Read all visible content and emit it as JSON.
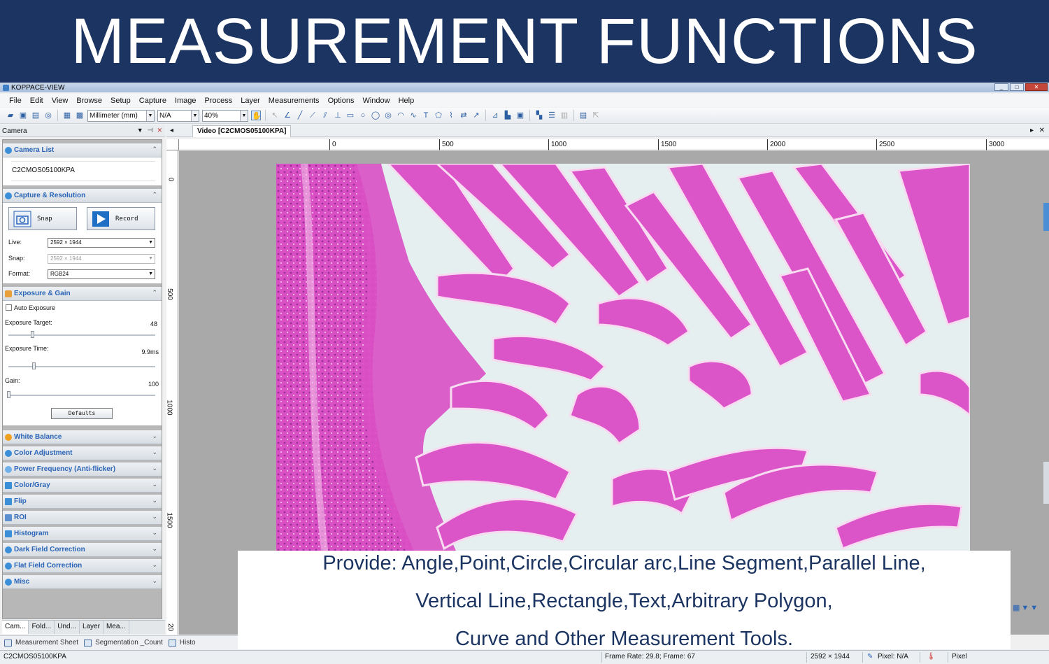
{
  "banner": {
    "title": "MEASUREMENT FUNCTIONS"
  },
  "window": {
    "title": "KOPPACE-VIEW"
  },
  "menu": [
    "File",
    "Edit",
    "View",
    "Browse",
    "Setup",
    "Capture",
    "Image",
    "Process",
    "Layer",
    "Measurements",
    "Options",
    "Window",
    "Help"
  ],
  "toolbar": {
    "unit": "Millimeter (mm)",
    "magnification": "N/A",
    "zoom": "40%"
  },
  "left_panel": {
    "header": "Camera",
    "camera_list": {
      "title": "Camera List",
      "camera": "C2CMOS05100KPA"
    },
    "capture": {
      "title": "Capture & Resolution",
      "snap_label": "Snap",
      "record_label": "Record",
      "live_label": "Live:",
      "live_value": "2592 × 1944",
      "snap_res_label": "Snap:",
      "snap_value": "2592 × 1944",
      "format_label": "Format:",
      "format_value": "RGB24"
    },
    "exposure": {
      "title": "Exposure & Gain",
      "auto_label": "Auto Exposure",
      "target_label": "Exposure Target:",
      "target_value": "48",
      "time_label": "Exposure Time:",
      "time_value": "9.9ms",
      "gain_label": "Gain:",
      "gain_value": "100",
      "defaults_label": "Defaults"
    },
    "sections": [
      "White Balance",
      "Color Adjustment",
      "Power Frequency (Anti-flicker)",
      "Color/Gray",
      "Flip",
      "ROI",
      "Histogram",
      "Dark Field Correction",
      "Flat Field Correction",
      "Misc"
    ],
    "bottom_tabs": [
      "Cam...",
      "Fold...",
      "Und...",
      "Layer",
      "Mea..."
    ]
  },
  "main": {
    "tab_label": "Video [C2CMOS05100KPA]",
    "h_ticks": [
      "0",
      "500",
      "1000",
      "1500",
      "2000",
      "2500",
      "3000"
    ],
    "v_ticks": [
      "0",
      "500",
      "1000",
      "1500",
      "20"
    ]
  },
  "caption": {
    "line1": "Provide: Angle,Point,Circle,Circular arc,Line Segment,Parallel Line,",
    "line2": "Vertical Line,Rectangle,Text,Arbitrary Polygon,",
    "line3": "Curve and Other Measurement Tools."
  },
  "bottom_sheets": [
    "Measurement Sheet",
    "Segmentation _Count",
    "Histo"
  ],
  "status": {
    "camera": "C2CMOS05100KPA",
    "frame": "Frame Rate: 29.8; Frame: 67",
    "resolution": "2592 × 1944",
    "pixel": "Pixel: N/A",
    "unit": "Pixel"
  },
  "colors": {
    "banner": "#1c3461",
    "accent": "#2a64b6",
    "tissue": "#d94fc4",
    "background_slide": "#e6efef"
  }
}
